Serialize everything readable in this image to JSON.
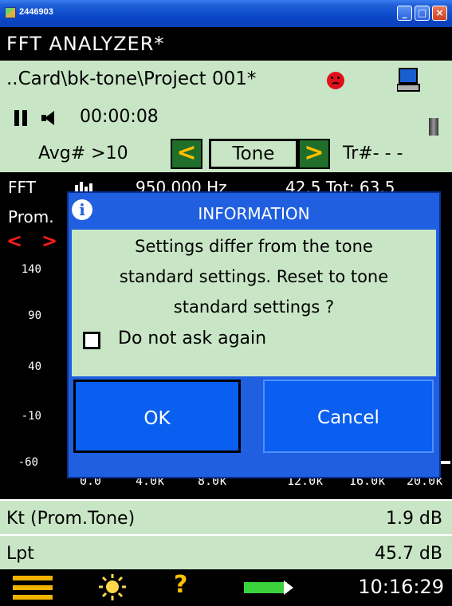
{
  "window": {
    "title": "2446903",
    "minimize": "_",
    "maximize": "□",
    "close": "×"
  },
  "header": {
    "title": "FFT ANALYZER*"
  },
  "project": {
    "path": "..Card\\bk-tone\\Project 001*"
  },
  "playback": {
    "elapsed": "00:00:08"
  },
  "template": {
    "avg": "Avg# >10",
    "left_arrow": "<",
    "name": "Tone",
    "right_arrow": ">",
    "tr": "Tr#- - -"
  },
  "plot": {
    "mode": "FFT",
    "frequency": "950.000 Hz",
    "level": "42.5 Tot: 63.5",
    "prom": "Prom.",
    "cursor_left": "<",
    "cursor_right": ">",
    "y_ticks": [
      "140",
      "90",
      "40",
      "-10",
      "-60"
    ],
    "x_ticks": [
      "0.0",
      "4.0k",
      "8.0k",
      "12.0k",
      "16.0k",
      "20.0k"
    ]
  },
  "dialog": {
    "title": "INFORMATION",
    "icon": "i",
    "message_lines": [
      "Settings differ from the tone",
      "standard settings. Reset to tone",
      "standard settings ?"
    ],
    "checkbox_label": "Do not ask again",
    "ok": "OK",
    "cancel": "Cancel"
  },
  "results": [
    {
      "label": "Kt (Prom.Tone)",
      "value": "1.9 dB"
    },
    {
      "label": "Lpt",
      "value": "45.7 dB"
    }
  ],
  "status": {
    "help": "?",
    "time": "10:16:29"
  },
  "colors": {
    "panel": "#c8e6c5",
    "dialog": "#1f5fe0",
    "button": "#0a5ef0",
    "accent": "#ffbf00"
  }
}
